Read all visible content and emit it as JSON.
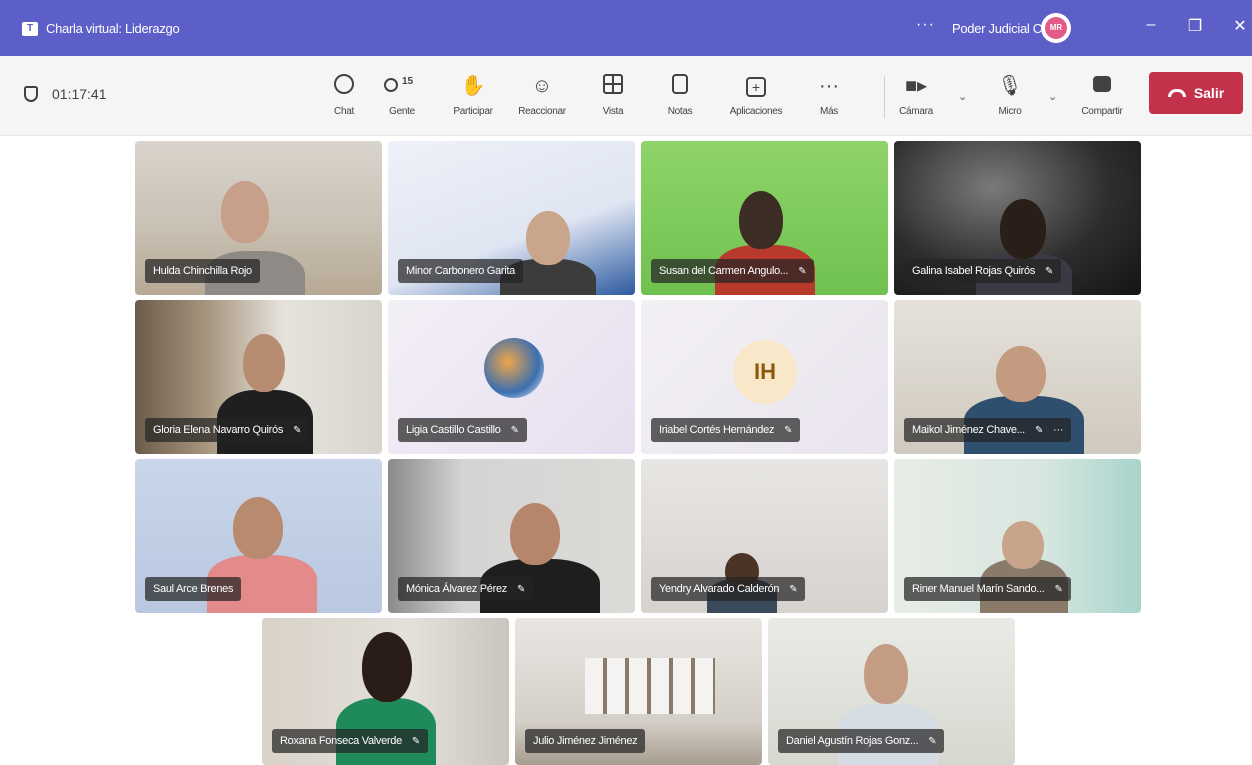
{
  "window": {
    "title": "Charla virtual: Liderazgo",
    "org": "Poder Judicial CR",
    "more": "···",
    "avatar_initials": "MR"
  },
  "toolbar": {
    "timer": "01:17:41",
    "people_count": "15",
    "buttons": {
      "chat": "Chat",
      "people": "Gente",
      "raise": "Participar",
      "react": "Reaccionar",
      "view": "Vista",
      "notes": "Notas",
      "apps": "Aplicaciones",
      "more": "Más",
      "camera": "Cámara",
      "mic": "Micro",
      "share": "Compartir"
    },
    "leave": "Salir"
  },
  "colors": {
    "brand": "#5b5fc7",
    "leave": "#c4314b"
  },
  "participants": [
    {
      "name": "Hulda Chinchilla Rojo"
    },
    {
      "name": "Minor Carbonero Garita"
    },
    {
      "name": "Susan del Carmen Angulo..."
    },
    {
      "name": "Galina Isabel Rojas Quirós"
    },
    {
      "name": "Gloria Elena Navarro Quirós"
    },
    {
      "name": "Ligia Castillo Castillo"
    },
    {
      "name": "Iriabel Cortés Hernández",
      "initials": "IH"
    },
    {
      "name": "Maikol Jiménez Chave..."
    },
    {
      "name": "Saul Arce Brenes"
    },
    {
      "name": "Mónica Álvarez Pérez"
    },
    {
      "name": "Yendry Alvarado Calderón"
    },
    {
      "name": "Riner Manuel Marín Sando..."
    },
    {
      "name": "Roxana Fonseca Valverde"
    },
    {
      "name": "Julio Jiménez Jiménez"
    },
    {
      "name": "Daniel Agustín Rojas Gonz..."
    }
  ]
}
